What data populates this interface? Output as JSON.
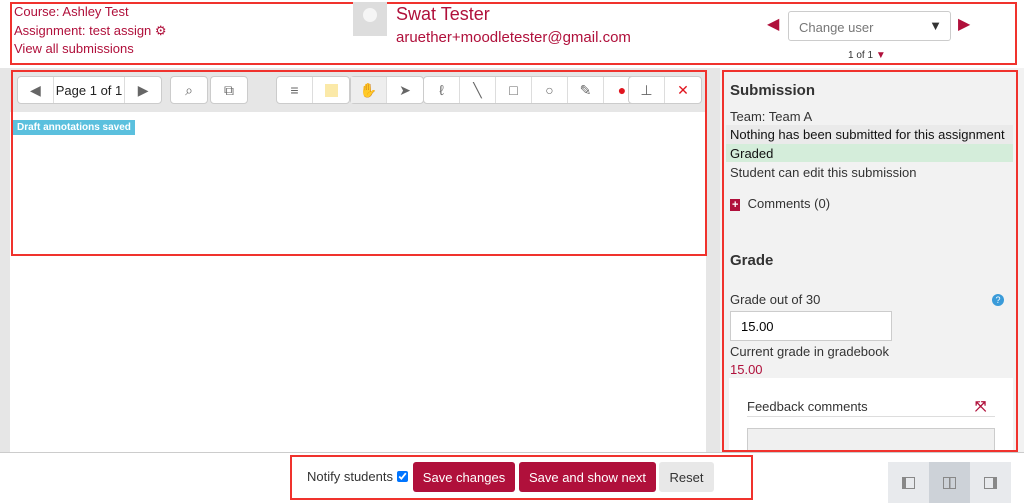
{
  "header": {
    "course": "Course: Ashley Test",
    "assignment": "Assignment: test assign",
    "view_all": "View all submissions",
    "user_name": "Swat Tester",
    "user_email": "aruether+moodletester@gmail.com",
    "change_user_placeholder": "Change user",
    "count": "1 of 1"
  },
  "toolbar": {
    "page_label": "Page 1 of 1",
    "status_badge": "Draft annotations saved"
  },
  "submission": {
    "title": "Submission",
    "team": "Team: Team A",
    "status": "Nothing has been submitted for this assignment",
    "grading_status": "Graded",
    "edit_status": "Student can edit this submission",
    "comments": "Comments (0)"
  },
  "grade": {
    "title": "Grade",
    "label": "Grade out of 30",
    "value": "15.00",
    "current_label": "Current grade in gradebook",
    "current_value": "15.00",
    "feedback_label": "Feedback comments"
  },
  "footer": {
    "notify_label": "Notify students",
    "notify_checked": true,
    "save": "Save changes",
    "save_next": "Save and show next",
    "reset": "Reset"
  },
  "colors": {
    "accent": "#b0103b",
    "badge": "#5bc0de",
    "graded": "#d4edda",
    "annotation_box": "#f0322d"
  }
}
